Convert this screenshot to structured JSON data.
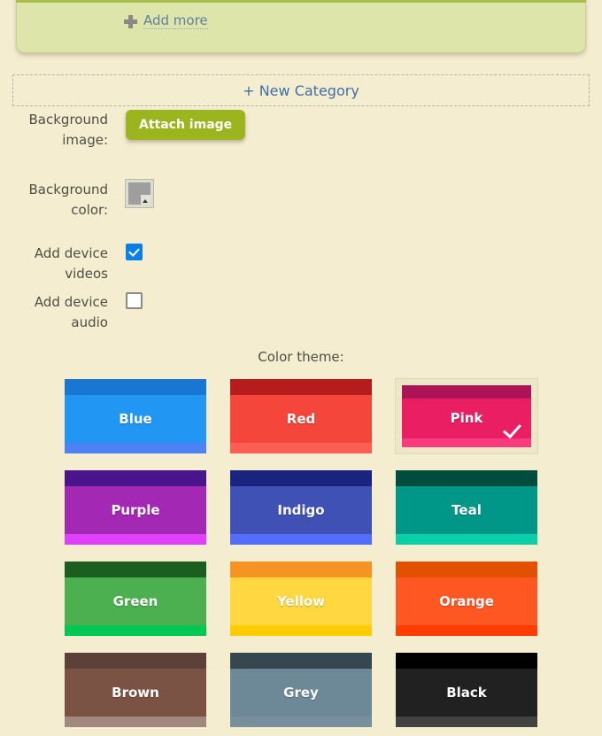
{
  "colors": {
    "page_background": "#f5edd0",
    "panel_background": "#dde5ab",
    "link_blue": "#3e6fa8",
    "button_green": "#9cb51e",
    "checkbox_blue": "#0b7fe8",
    "selected_frame": "#ece7c6"
  },
  "panel": {
    "add_more_label": "Add more",
    "add_more_icon": "plus-icon"
  },
  "new_category": {
    "label": "+ New Category"
  },
  "form": {
    "rows": [
      {
        "label": "Background image:",
        "control": "attach-image-button",
        "value": "Attach image"
      },
      {
        "label": "Background color:",
        "control": "color-swatch",
        "value": "#9e9e9e"
      },
      {
        "label": "Add device videos",
        "control": "checkbox",
        "checked": true
      },
      {
        "label": "Add device audio",
        "control": "checkbox",
        "checked": false
      }
    ]
  },
  "theme": {
    "title": "Color theme:",
    "selected": "Pink",
    "check_icon": "check-icon",
    "options": [
      {
        "name": "Blue",
        "top": "#1976d2",
        "main": "#2196f3",
        "bottom": "#4d82f7",
        "selected": false
      },
      {
        "name": "Red",
        "top": "#b71c1c",
        "main": "#f4463a",
        "bottom": "#fd5e54",
        "selected": false
      },
      {
        "name": "Pink",
        "top": "#ad1457",
        "main": "#e91e63",
        "bottom": "#fb3b7f",
        "selected": true
      },
      {
        "name": "Purple",
        "top": "#4a148c",
        "main": "#a328b4",
        "bottom": "#e040fb",
        "selected": false
      },
      {
        "name": "Indigo",
        "top": "#1a237e",
        "main": "#3f51b5",
        "bottom": "#536dfe",
        "selected": false
      },
      {
        "name": "Teal",
        "top": "#004d40",
        "main": "#009688",
        "bottom": "#0bcfa9",
        "selected": false
      },
      {
        "name": "Green",
        "top": "#1b5e20",
        "main": "#4caf50",
        "bottom": "#00c853",
        "selected": false
      },
      {
        "name": "Yellow",
        "top": "#f79322",
        "main": "#ffd740",
        "bottom": "#ffcc00",
        "selected": false
      },
      {
        "name": "Orange",
        "top": "#e25100",
        "main": "#ff5722",
        "bottom": "#ff3d00",
        "selected": false
      },
      {
        "name": "Brown",
        "top": "#5d4037",
        "main": "#7b5344",
        "bottom": "#a1887f",
        "selected": false
      },
      {
        "name": "Grey",
        "top": "#37474f",
        "main": "#6d8896",
        "bottom": "#78909c",
        "selected": false
      },
      {
        "name": "Black",
        "top": "#000000",
        "main": "#212121",
        "bottom": "#424242",
        "selected": false
      }
    ]
  }
}
